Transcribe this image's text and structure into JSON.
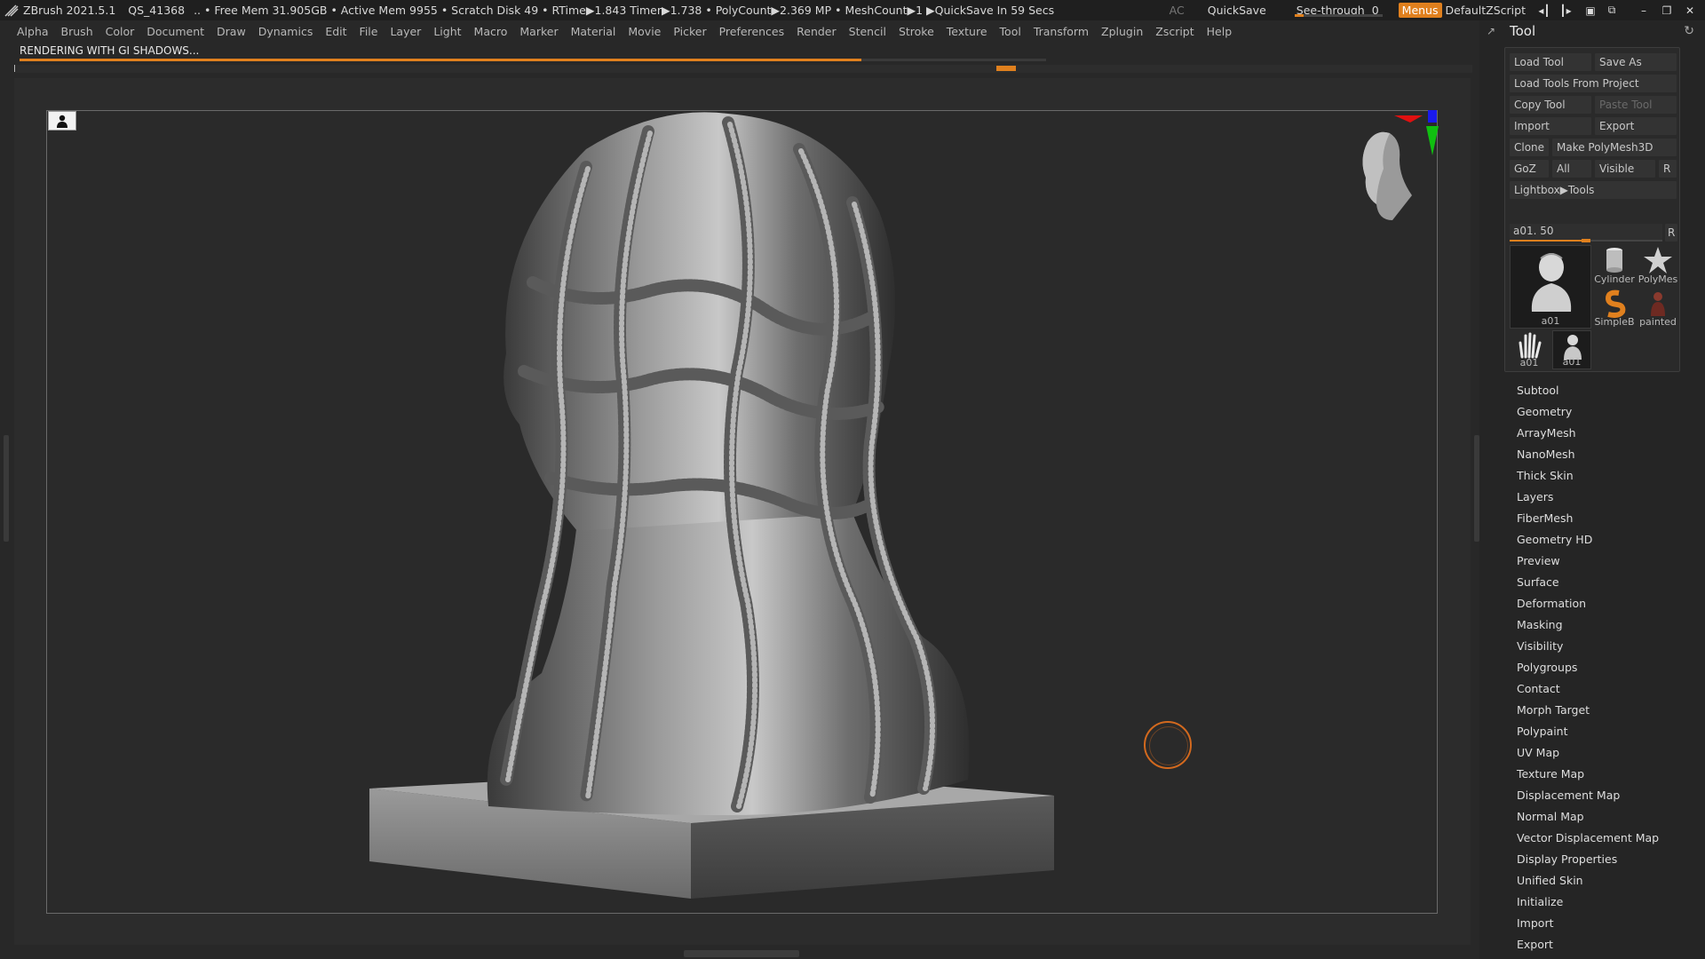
{
  "titlebar": {
    "app": "ZBrush 2021.5.1",
    "qs": "QS_41368",
    "stats": ".. • Free Mem 31.905GB • Active Mem 9955 • Scratch Disk 49 •  RTime▶1.843 Timer▶1.738 • PolyCount▶2.369 MP  • MeshCount▶1  ▶QuickSave In 59 Secs",
    "ac": "AC",
    "quicksave": "QuickSave",
    "see_through": "See-through",
    "see_through_value": "0",
    "menus": "Menus",
    "script": "DefaultZScript"
  },
  "menubar": [
    "Alpha",
    "Brush",
    "Color",
    "Document",
    "Draw",
    "Dynamics",
    "Edit",
    "File",
    "Layer",
    "Light",
    "Macro",
    "Marker",
    "Material",
    "Movie",
    "Picker",
    "Preferences",
    "Render",
    "Stencil",
    "Stroke",
    "Texture",
    "Tool",
    "Transform",
    "Zplugin",
    "Zscript",
    "Help"
  ],
  "render": {
    "status": "RENDERING WITH GI SHADOWS...",
    "progress": 0.82
  },
  "tool_panel": {
    "title": "Tool",
    "buttons": {
      "load_tool": "Load Tool",
      "save_as": "Save As",
      "load_from_project": "Load Tools From Project",
      "copy_tool": "Copy Tool",
      "paste_tool": "Paste Tool",
      "import": "Import",
      "export": "Export",
      "clone": "Clone",
      "make_polymesh": "Make PolyMesh3D",
      "goz": "GoZ",
      "all": "All",
      "visible": "Visible",
      "r": "R",
      "lightbox": "Lightbox▶Tools"
    },
    "slider": {
      "label": "a01. 50",
      "value": 0.5,
      "r": "R"
    },
    "thumbnails": {
      "main": "a01",
      "cylinder": "Cylinder",
      "polymesh": "PolyMes",
      "simpleb": "SimpleB",
      "painted": "painted",
      "hand": "a01",
      "bust": "a01"
    },
    "sections": [
      "Subtool",
      "Geometry",
      "ArrayMesh",
      "NanoMesh",
      "Thick Skin",
      "Layers",
      "FiberMesh",
      "Geometry HD",
      "Preview",
      "Surface",
      "Deformation",
      "Masking",
      "Visibility",
      "Polygroups",
      "Contact",
      "Morph Target",
      "Polypaint",
      "UV Map",
      "Texture Map",
      "Displacement Map",
      "Normal Map",
      "Vector Displacement Map",
      "Display Properties",
      "Unified Skin",
      "Initialize",
      "Import",
      "Export"
    ]
  },
  "colors": {
    "accent": "#e0801e",
    "background": "#282828",
    "panel": "#252525"
  }
}
